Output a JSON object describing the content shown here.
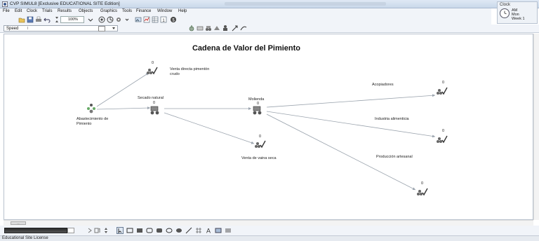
{
  "window": {
    "title": "CVP  SIMUL8 [Exclusive EDUCATIONAL SITE Edition]"
  },
  "clock": {
    "title": "Clock",
    "lines": [
      "AM",
      "Mon",
      "Week 1"
    ]
  },
  "menu": [
    "File",
    "Edit",
    "Clock",
    "Trials",
    "Results",
    "Objects",
    "Graphics",
    "Tools",
    "Finance",
    "Window",
    "Help"
  ],
  "toolbar": {
    "zoom": "100%"
  },
  "speed": {
    "label": "Speed",
    "marker": "I"
  },
  "canvas": {
    "title": "Cadena de Valor del Pimiento",
    "nodes": [
      {
        "id": "entry",
        "label": "Abastecimiento de\nPimiento",
        "count": ""
      },
      {
        "id": "secado",
        "label": "Secado natural",
        "count": "0"
      },
      {
        "id": "venta-directa",
        "label": "Venta directa pimentón\ncrudo",
        "count": "0"
      },
      {
        "id": "molienda",
        "label": "Molienda",
        "count": "0"
      },
      {
        "id": "vaina-seca",
        "label": "Venta de vaina seca",
        "count": "0"
      },
      {
        "id": "acopiadores",
        "label": "Acopiadores",
        "count": "0"
      },
      {
        "id": "industria",
        "label": "Industria alimenticia",
        "count": "0"
      },
      {
        "id": "artesanal",
        "label": "Producción artesanal",
        "count": "0"
      }
    ]
  },
  "scrollbar": {
    "thumb": "..."
  },
  "status": {
    "text": "Educational Site License"
  },
  "colors": {
    "titlebar": "#c9d8ea",
    "toolbar": "#f1f4f9",
    "route_line": "#9aa3ad"
  }
}
